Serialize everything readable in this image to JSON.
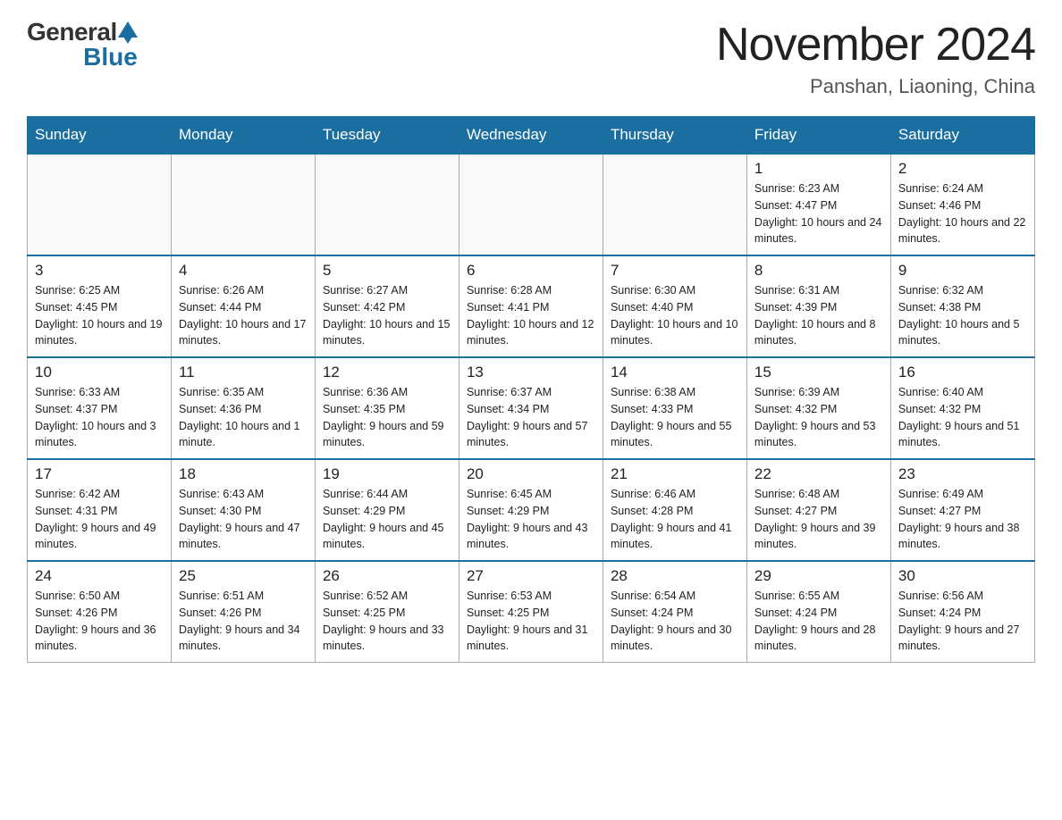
{
  "header": {
    "logo_general": "General",
    "logo_blue": "Blue",
    "month_year": "November 2024",
    "location": "Panshan, Liaoning, China"
  },
  "days_of_week": [
    "Sunday",
    "Monday",
    "Tuesday",
    "Wednesday",
    "Thursday",
    "Friday",
    "Saturday"
  ],
  "weeks": [
    [
      {
        "day": "",
        "info": ""
      },
      {
        "day": "",
        "info": ""
      },
      {
        "day": "",
        "info": ""
      },
      {
        "day": "",
        "info": ""
      },
      {
        "day": "",
        "info": ""
      },
      {
        "day": "1",
        "info": "Sunrise: 6:23 AM\nSunset: 4:47 PM\nDaylight: 10 hours and 24 minutes."
      },
      {
        "day": "2",
        "info": "Sunrise: 6:24 AM\nSunset: 4:46 PM\nDaylight: 10 hours and 22 minutes."
      }
    ],
    [
      {
        "day": "3",
        "info": "Sunrise: 6:25 AM\nSunset: 4:45 PM\nDaylight: 10 hours and 19 minutes."
      },
      {
        "day": "4",
        "info": "Sunrise: 6:26 AM\nSunset: 4:44 PM\nDaylight: 10 hours and 17 minutes."
      },
      {
        "day": "5",
        "info": "Sunrise: 6:27 AM\nSunset: 4:42 PM\nDaylight: 10 hours and 15 minutes."
      },
      {
        "day": "6",
        "info": "Sunrise: 6:28 AM\nSunset: 4:41 PM\nDaylight: 10 hours and 12 minutes."
      },
      {
        "day": "7",
        "info": "Sunrise: 6:30 AM\nSunset: 4:40 PM\nDaylight: 10 hours and 10 minutes."
      },
      {
        "day": "8",
        "info": "Sunrise: 6:31 AM\nSunset: 4:39 PM\nDaylight: 10 hours and 8 minutes."
      },
      {
        "day": "9",
        "info": "Sunrise: 6:32 AM\nSunset: 4:38 PM\nDaylight: 10 hours and 5 minutes."
      }
    ],
    [
      {
        "day": "10",
        "info": "Sunrise: 6:33 AM\nSunset: 4:37 PM\nDaylight: 10 hours and 3 minutes."
      },
      {
        "day": "11",
        "info": "Sunrise: 6:35 AM\nSunset: 4:36 PM\nDaylight: 10 hours and 1 minute."
      },
      {
        "day": "12",
        "info": "Sunrise: 6:36 AM\nSunset: 4:35 PM\nDaylight: 9 hours and 59 minutes."
      },
      {
        "day": "13",
        "info": "Sunrise: 6:37 AM\nSunset: 4:34 PM\nDaylight: 9 hours and 57 minutes."
      },
      {
        "day": "14",
        "info": "Sunrise: 6:38 AM\nSunset: 4:33 PM\nDaylight: 9 hours and 55 minutes."
      },
      {
        "day": "15",
        "info": "Sunrise: 6:39 AM\nSunset: 4:32 PM\nDaylight: 9 hours and 53 minutes."
      },
      {
        "day": "16",
        "info": "Sunrise: 6:40 AM\nSunset: 4:32 PM\nDaylight: 9 hours and 51 minutes."
      }
    ],
    [
      {
        "day": "17",
        "info": "Sunrise: 6:42 AM\nSunset: 4:31 PM\nDaylight: 9 hours and 49 minutes."
      },
      {
        "day": "18",
        "info": "Sunrise: 6:43 AM\nSunset: 4:30 PM\nDaylight: 9 hours and 47 minutes."
      },
      {
        "day": "19",
        "info": "Sunrise: 6:44 AM\nSunset: 4:29 PM\nDaylight: 9 hours and 45 minutes."
      },
      {
        "day": "20",
        "info": "Sunrise: 6:45 AM\nSunset: 4:29 PM\nDaylight: 9 hours and 43 minutes."
      },
      {
        "day": "21",
        "info": "Sunrise: 6:46 AM\nSunset: 4:28 PM\nDaylight: 9 hours and 41 minutes."
      },
      {
        "day": "22",
        "info": "Sunrise: 6:48 AM\nSunset: 4:27 PM\nDaylight: 9 hours and 39 minutes."
      },
      {
        "day": "23",
        "info": "Sunrise: 6:49 AM\nSunset: 4:27 PM\nDaylight: 9 hours and 38 minutes."
      }
    ],
    [
      {
        "day": "24",
        "info": "Sunrise: 6:50 AM\nSunset: 4:26 PM\nDaylight: 9 hours and 36 minutes."
      },
      {
        "day": "25",
        "info": "Sunrise: 6:51 AM\nSunset: 4:26 PM\nDaylight: 9 hours and 34 minutes."
      },
      {
        "day": "26",
        "info": "Sunrise: 6:52 AM\nSunset: 4:25 PM\nDaylight: 9 hours and 33 minutes."
      },
      {
        "day": "27",
        "info": "Sunrise: 6:53 AM\nSunset: 4:25 PM\nDaylight: 9 hours and 31 minutes."
      },
      {
        "day": "28",
        "info": "Sunrise: 6:54 AM\nSunset: 4:24 PM\nDaylight: 9 hours and 30 minutes."
      },
      {
        "day": "29",
        "info": "Sunrise: 6:55 AM\nSunset: 4:24 PM\nDaylight: 9 hours and 28 minutes."
      },
      {
        "day": "30",
        "info": "Sunrise: 6:56 AM\nSunset: 4:24 PM\nDaylight: 9 hours and 27 minutes."
      }
    ]
  ]
}
